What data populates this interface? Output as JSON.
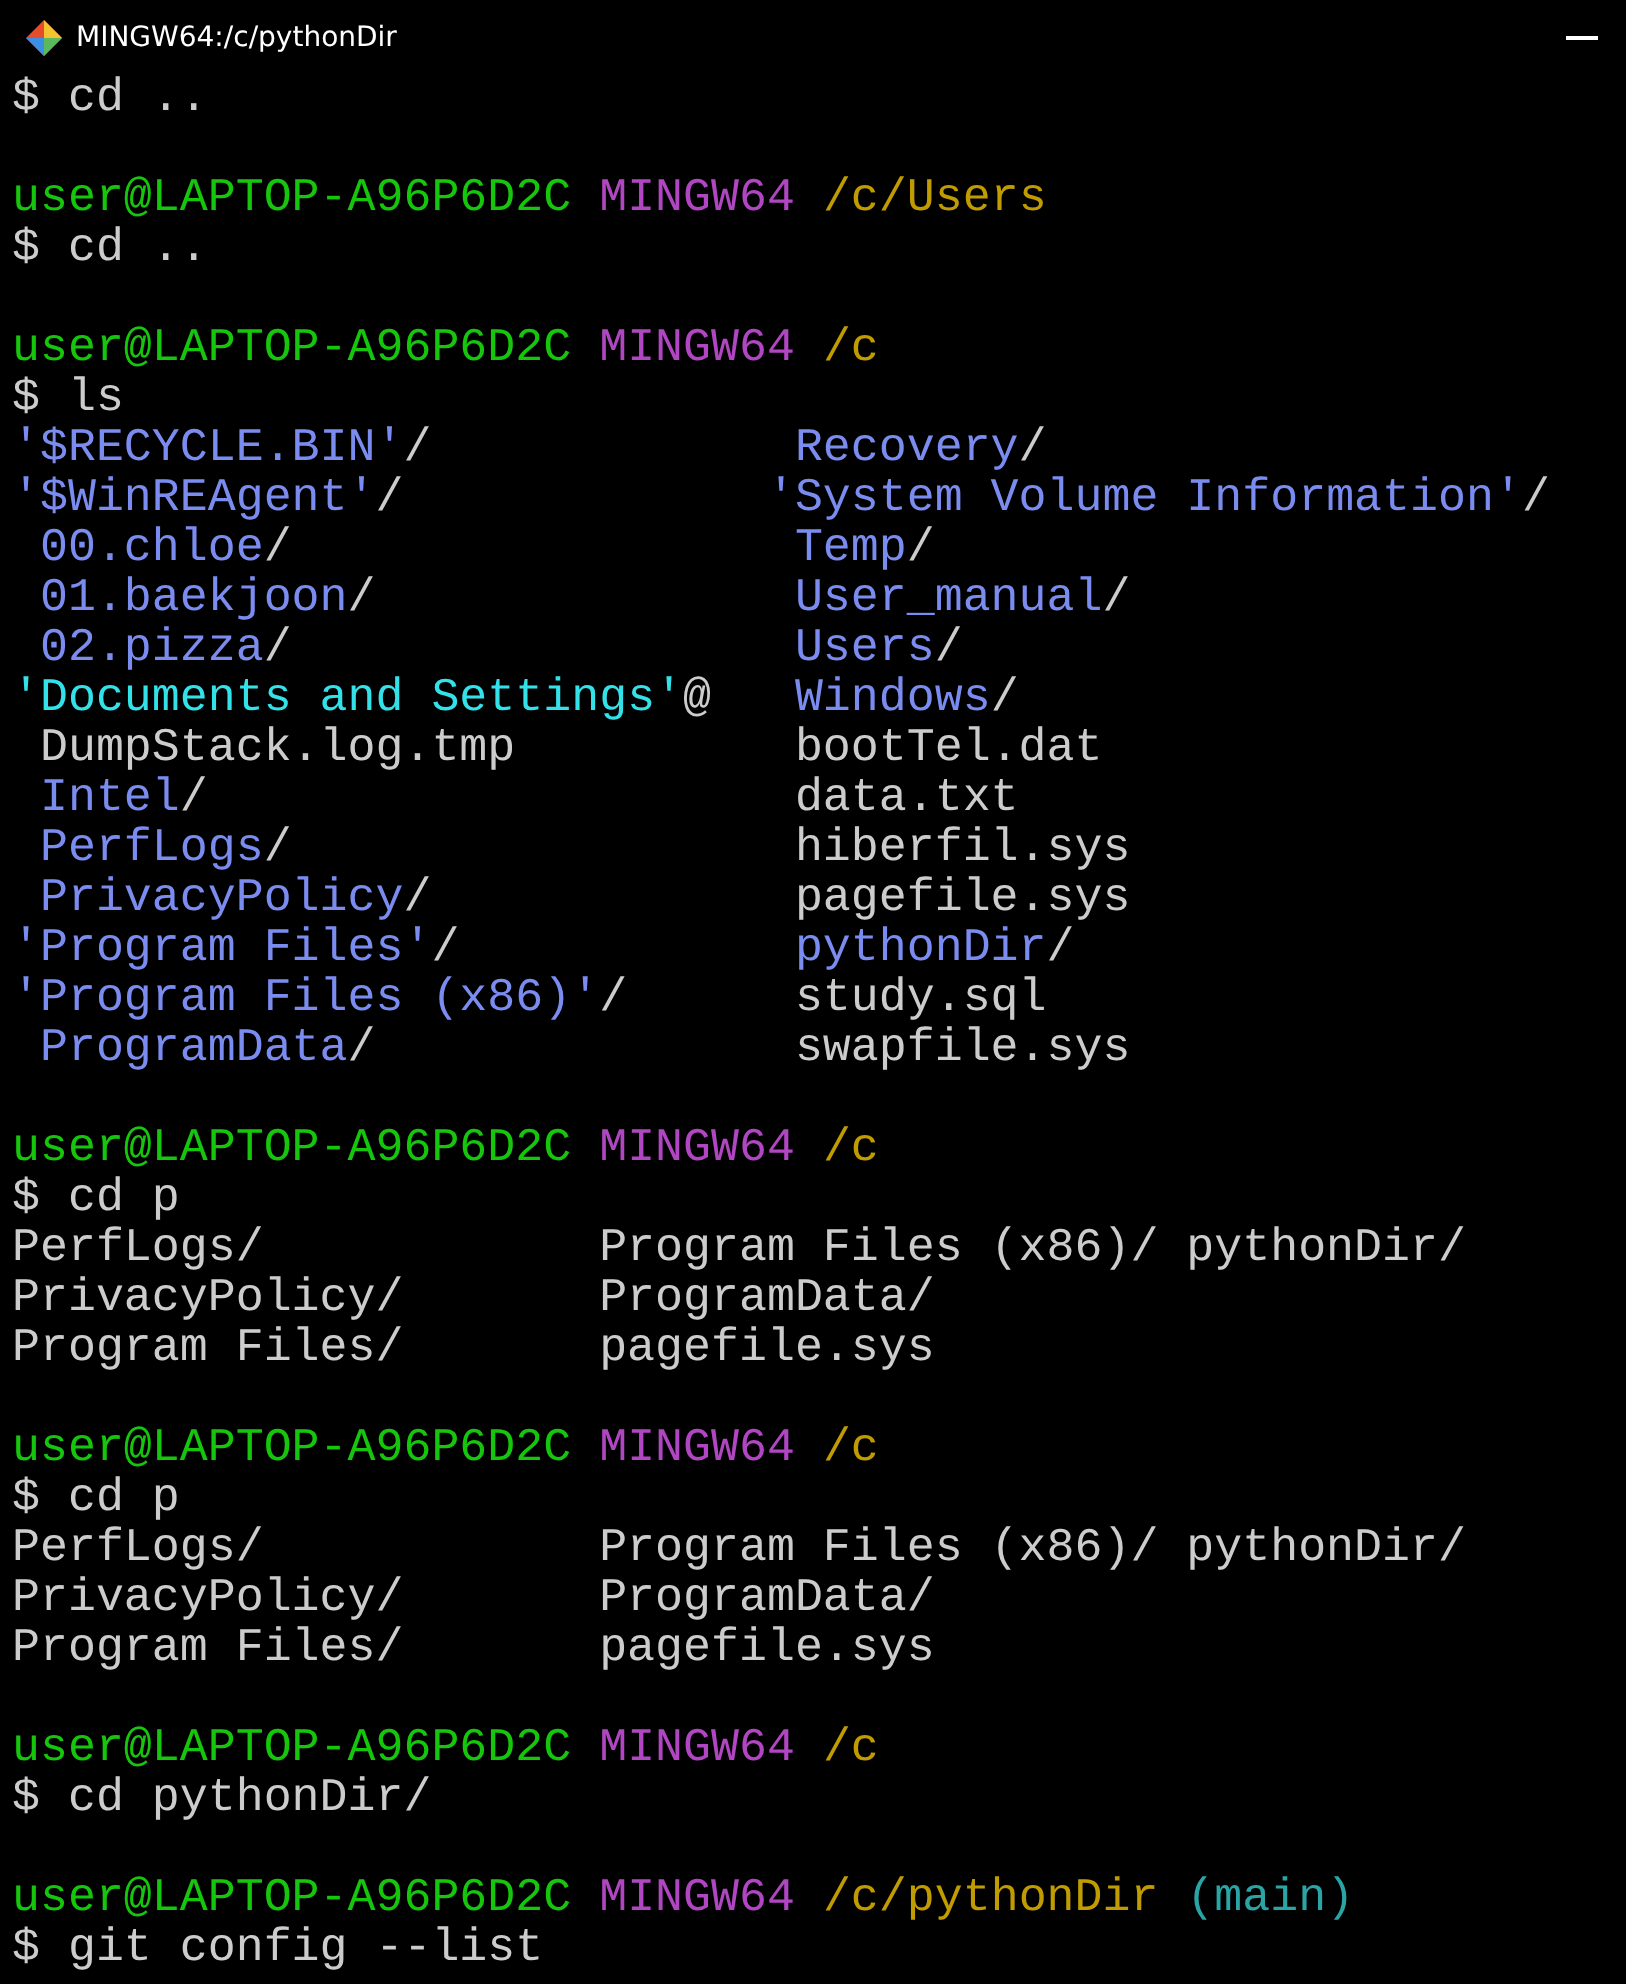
{
  "window": {
    "title": "MINGW64:/c/pythonDir"
  },
  "lines": [
    {
      "kind": "command",
      "text": "$ cd .."
    },
    {
      "kind": "blank"
    },
    {
      "kind": "prompt",
      "user_host": "user@LAPTOP-A96P6D2C",
      "system": "MINGW64",
      "path": "/c/Users"
    },
    {
      "kind": "command",
      "text": "$ cd .."
    },
    {
      "kind": "blank"
    },
    {
      "kind": "prompt",
      "user_host": "user@LAPTOP-A96P6D2C",
      "system": "MINGW64",
      "path": "/c"
    },
    {
      "kind": "command",
      "text": "$ ls"
    },
    {
      "kind": "listing",
      "rows": [
        [
          {
            "text": "'$RECYCLE.BIN'",
            "kind": "folder",
            "suffix": "/"
          },
          {
            "text": " Recovery",
            "kind": "folder",
            "suffix": "/"
          }
        ],
        [
          {
            "text": "'$WinREAgent'",
            "kind": "folder",
            "suffix": "/"
          },
          {
            "text": "'System Volume Information'",
            "kind": "folder",
            "suffix": "/"
          }
        ],
        [
          {
            "text": " 00.chloe",
            "kind": "folder",
            "suffix": "/"
          },
          {
            "text": " Temp",
            "kind": "folder",
            "suffix": "/"
          }
        ],
        [
          {
            "text": " 01.baekjoon",
            "kind": "folder",
            "suffix": "/"
          },
          {
            "text": " User_manual",
            "kind": "folder",
            "suffix": "/"
          }
        ],
        [
          {
            "text": " 02.pizza",
            "kind": "folder",
            "suffix": "/"
          },
          {
            "text": " Users",
            "kind": "folder",
            "suffix": "/"
          }
        ],
        [
          {
            "text": "'Documents and Settings'",
            "kind": "link",
            "suffix": "@"
          },
          {
            "text": " Windows",
            "kind": "folder",
            "suffix": "/"
          }
        ],
        [
          {
            "text": " DumpStack.log.tmp",
            "kind": "file"
          },
          {
            "text": " bootTel.dat",
            "kind": "file"
          }
        ],
        [
          {
            "text": " Intel",
            "kind": "folder",
            "suffix": "/"
          },
          {
            "text": " data.txt",
            "kind": "file"
          }
        ],
        [
          {
            "text": " PerfLogs",
            "kind": "folder",
            "suffix": "/"
          },
          {
            "text": " hiberfil.sys",
            "kind": "file"
          }
        ],
        [
          {
            "text": " PrivacyPolicy",
            "kind": "folder",
            "suffix": "/"
          },
          {
            "text": " pagefile.sys",
            "kind": "file"
          }
        ],
        [
          {
            "text": "'Program Files'",
            "kind": "folder",
            "suffix": "/"
          },
          {
            "text": " pythonDir",
            "kind": "folder",
            "suffix": "/"
          }
        ],
        [
          {
            "text": "'Program Files (x86)'",
            "kind": "folder",
            "suffix": "/"
          },
          {
            "text": " study.sql",
            "kind": "file"
          }
        ],
        [
          {
            "text": " ProgramData",
            "kind": "folder",
            "suffix": "/"
          },
          {
            "text": " swapfile.sys",
            "kind": "file"
          }
        ]
      ]
    },
    {
      "kind": "blank"
    },
    {
      "kind": "prompt",
      "user_host": "user@LAPTOP-A96P6D2C",
      "system": "MINGW64",
      "path": "/c"
    },
    {
      "kind": "command",
      "text": "$ cd p"
    },
    {
      "kind": "listing",
      "rows": [
        [
          {
            "text": "PerfLogs/",
            "kind": "file"
          },
          {
            "text": "Program Files (x86)/",
            "kind": "file"
          },
          {
            "text": "pythonDir/",
            "kind": "file"
          }
        ],
        [
          {
            "text": "PrivacyPolicy/",
            "kind": "file"
          },
          {
            "text": "ProgramData/",
            "kind": "file"
          }
        ],
        [
          {
            "text": "Program Files/",
            "kind": "file"
          },
          {
            "text": "pagefile.sys",
            "kind": "file"
          }
        ]
      ]
    },
    {
      "kind": "blank"
    },
    {
      "kind": "prompt",
      "user_host": "user@LAPTOP-A96P6D2C",
      "system": "MINGW64",
      "path": "/c"
    },
    {
      "kind": "command",
      "text": "$ cd p"
    },
    {
      "kind": "listing",
      "rows": [
        [
          {
            "text": "PerfLogs/",
            "kind": "file"
          },
          {
            "text": "Program Files (x86)/",
            "kind": "file"
          },
          {
            "text": "pythonDir/",
            "kind": "file"
          }
        ],
        [
          {
            "text": "PrivacyPolicy/",
            "kind": "file"
          },
          {
            "text": "ProgramData/",
            "kind": "file"
          }
        ],
        [
          {
            "text": "Program Files/",
            "kind": "file"
          },
          {
            "text": "pagefile.sys",
            "kind": "file"
          }
        ]
      ]
    },
    {
      "kind": "blank"
    },
    {
      "kind": "prompt",
      "user_host": "user@LAPTOP-A96P6D2C",
      "system": "MINGW64",
      "path": "/c"
    },
    {
      "kind": "command",
      "text": "$ cd pythonDir/"
    },
    {
      "kind": "blank"
    },
    {
      "kind": "prompt",
      "user_host": "user@LAPTOP-A96P6D2C",
      "system": "MINGW64",
      "path": "/c/pythonDir",
      "branch": "(main)"
    },
    {
      "kind": "command",
      "text": "$ git config --list"
    }
  ]
}
